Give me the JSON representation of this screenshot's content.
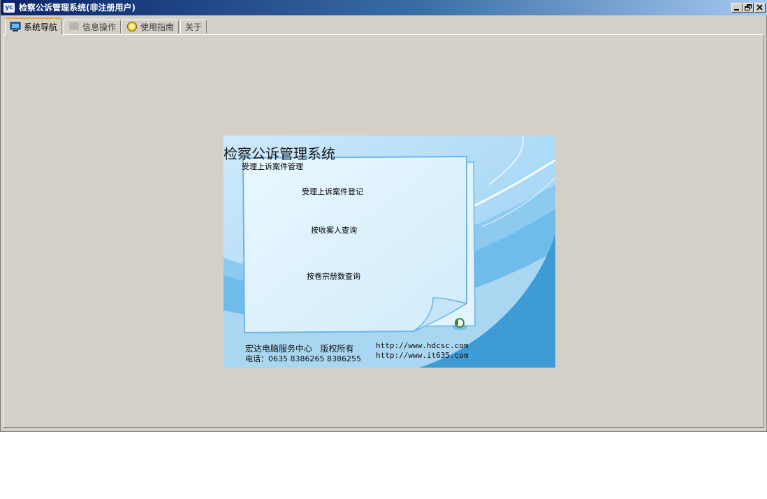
{
  "window": {
    "title": "检察公诉管理系统(非注册用户)",
    "app_icon_text": "yc"
  },
  "tabs": [
    {
      "label": "系统导航",
      "icon": "monitor-icon",
      "active": true
    },
    {
      "label": "信息操作",
      "icon": "grid-icon",
      "active": false
    },
    {
      "label": "使用指南",
      "icon": "help-icon",
      "active": false
    },
    {
      "label": "关于",
      "icon": "",
      "active": false
    }
  ],
  "splash": {
    "title": "检察公诉管理系统",
    "subtitle": "受理上诉案件管理",
    "links": [
      "受理上诉案件登记",
      "按收案人查询",
      "按卷宗册数查询"
    ],
    "footer_company": "宏达电脑服务中心   版权所有",
    "footer_phone": "电话：0635 8386265 8386255",
    "url1": "http://www.hdcsc.com",
    "url2": "http://www.it635.com"
  },
  "colors": {
    "titlebar_start": "#0a246a",
    "titlebar_end": "#a6caf0",
    "face": "#d4d0c8",
    "splash_blue": "#3d9bd6",
    "note": "#dff2fc"
  }
}
